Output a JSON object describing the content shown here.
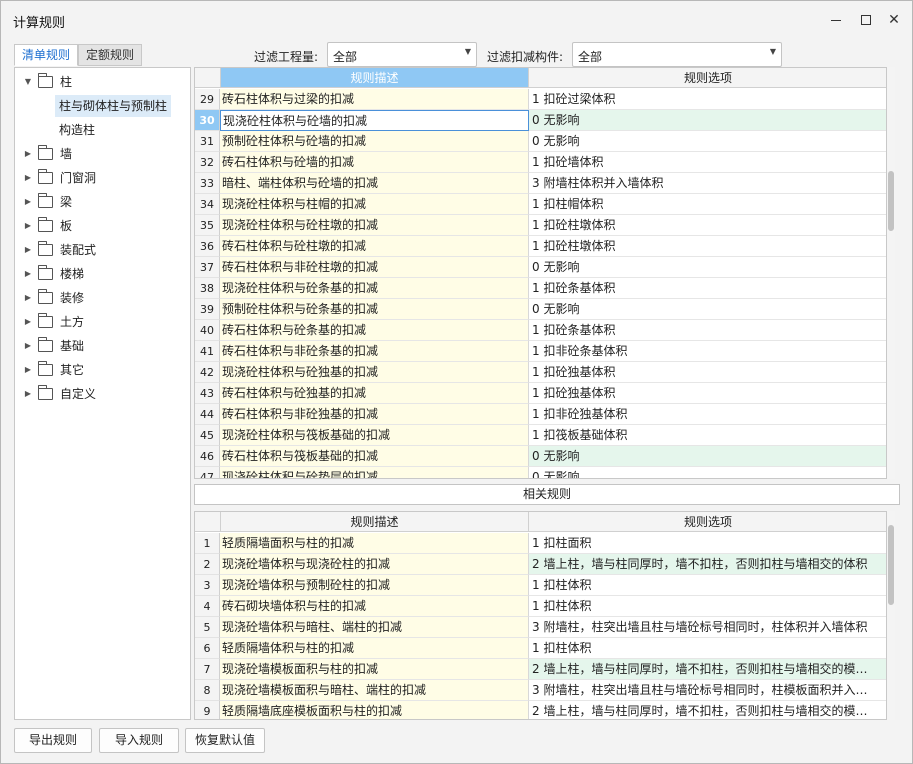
{
  "window": {
    "title": "计算规则"
  },
  "tabs": [
    {
      "label": "清单规则",
      "active": true
    },
    {
      "label": "定额规则",
      "active": false
    }
  ],
  "filters": {
    "quantity_label": "过滤工程量:",
    "quantity_value": "全部",
    "component_label": "过滤扣减构件:",
    "component_value": "全部"
  },
  "tree": [
    {
      "label": "柱",
      "expanded": true
    },
    {
      "label": "柱与砌体柱与预制柱",
      "selected": true
    },
    {
      "label": "构造柱"
    },
    {
      "label": "墙"
    },
    {
      "label": "门窗洞"
    },
    {
      "label": "梁"
    },
    {
      "label": "板"
    },
    {
      "label": "装配式"
    },
    {
      "label": "楼梯"
    },
    {
      "label": "装修"
    },
    {
      "label": "土方"
    },
    {
      "label": "基础"
    },
    {
      "label": "其它"
    },
    {
      "label": "自定义"
    }
  ],
  "top_grid": {
    "headers": {
      "desc": "规则描述",
      "option": "规则选项"
    },
    "current_row": 30,
    "rows": [
      {
        "num": "29",
        "desc": "砖石柱体积与过梁的扣减",
        "option": "1  扣砼过梁体积"
      },
      {
        "num": "30",
        "desc": "现浇砼柱体积与砼墙的扣减",
        "option": "0    无影响",
        "highlight": true
      },
      {
        "num": "31",
        "desc": "预制砼柱体积与砼墙的扣减",
        "option": "0    无影响"
      },
      {
        "num": "32",
        "desc": "砖石柱体积与砼墙的扣减",
        "option": "1  扣砼墙体积"
      },
      {
        "num": "33",
        "desc": "暗柱、端柱体积与砼墙的扣减",
        "option": "3  附墙柱体积并入墙体积"
      },
      {
        "num": "34",
        "desc": "现浇砼柱体积与柱帽的扣减",
        "option": "1  扣柱帽体积"
      },
      {
        "num": "35",
        "desc": "现浇砼柱体积与砼柱墩的扣减",
        "option": "1  扣砼柱墩体积"
      },
      {
        "num": "36",
        "desc": "砖石柱体积与砼柱墩的扣减",
        "option": "1  扣砼柱墩体积"
      },
      {
        "num": "37",
        "desc": "砖石柱体积与非砼柱墩的扣减",
        "option": "0    无影响"
      },
      {
        "num": "38",
        "desc": "现浇砼柱体积与砼条基的扣减",
        "option": "1  扣砼条基体积"
      },
      {
        "num": "39",
        "desc": "预制砼柱体积与砼条基的扣减",
        "option": "0    无影响"
      },
      {
        "num": "40",
        "desc": "砖石柱体积与砼条基的扣减",
        "option": "1  扣砼条基体积"
      },
      {
        "num": "41",
        "desc": "砖石柱体积与非砼条基的扣减",
        "option": "1  扣非砼条基体积"
      },
      {
        "num": "42",
        "desc": "现浇砼柱体积与砼独基的扣减",
        "option": "1  扣砼独基体积"
      },
      {
        "num": "43",
        "desc": "砖石柱体积与砼独基的扣减",
        "option": "1  扣砼独基体积"
      },
      {
        "num": "44",
        "desc": "砖石柱体积与非砼独基的扣减",
        "option": "1  扣非砼独基体积"
      },
      {
        "num": "45",
        "desc": "现浇砼柱体积与筏板基础的扣减",
        "option": "1  扣筏板基础体积"
      },
      {
        "num": "46",
        "desc": "砖石柱体积与筏板基础的扣减",
        "option": "0    无影响",
        "highlight": true
      },
      {
        "num": "47",
        "desc": "现浇砼柱体积与砼垫层的扣减",
        "option": "0    无影响"
      }
    ]
  },
  "related_button": "相关规则",
  "bottom_grid": {
    "headers": {
      "desc": "规则描述",
      "option": "规则选项"
    },
    "rows": [
      {
        "num": "1",
        "desc": "轻质隔墙面积与柱的扣减",
        "option": "1    扣柱面积"
      },
      {
        "num": "2",
        "desc": "现浇砼墙体积与现浇砼柱的扣减",
        "option": "2    墙上柱，墙与柱同厚时，墙不扣柱，否则扣柱与墙相交的体积",
        "highlight": true
      },
      {
        "num": "3",
        "desc": "现浇砼墙体积与预制砼柱的扣减",
        "option": "1    扣柱体积"
      },
      {
        "num": "4",
        "desc": "砖石砌块墙体积与柱的扣减",
        "option": "1    扣柱体积"
      },
      {
        "num": "5",
        "desc": "现浇砼墙体积与暗柱、端柱的扣减",
        "option": "3    附墙柱，柱突出墙且柱与墙砼标号相同时，柱体积并入墙体积"
      },
      {
        "num": "6",
        "desc": "轻质隔墙体积与柱的扣减",
        "option": "1    扣柱体积"
      },
      {
        "num": "7",
        "desc": "现浇砼墙模板面积与柱的扣减",
        "option": "2    墙上柱，墙与柱同厚时，墙不扣柱，否则扣柱与墙相交的模…",
        "highlight": true
      },
      {
        "num": "8",
        "desc": "现浇砼墙模板面积与暗柱、端柱的扣减",
        "option": "3    附墙柱，柱突出墙且柱与墙砼标号相同时，柱模板面积并入…"
      },
      {
        "num": "9",
        "desc": "轻质隔墙底座模板面积与柱的扣减",
        "option": "2    墙上柱，墙与柱同厚时，墙不扣柱，否则扣柱与墙相交的模…"
      }
    ]
  },
  "footer": {
    "export_label": "导出规则",
    "import_label": "导入规则",
    "restore_label": "恢复默认值"
  }
}
